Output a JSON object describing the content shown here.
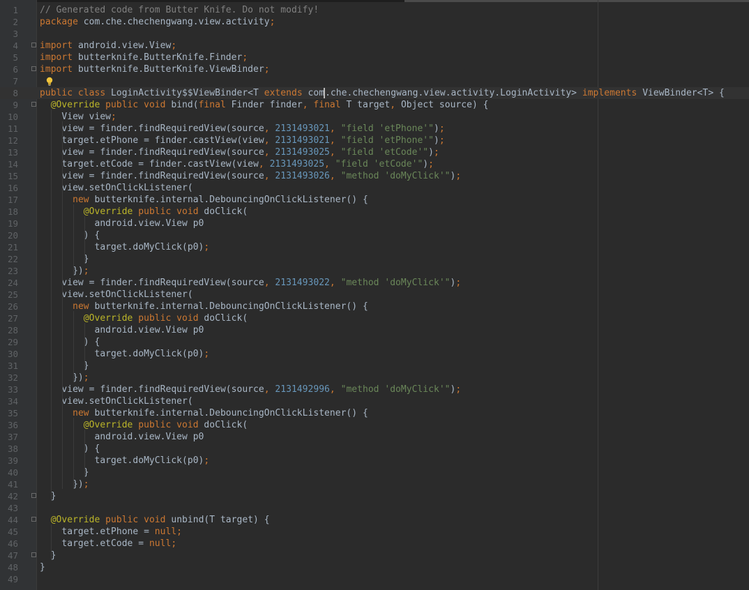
{
  "editor": {
    "theme_colors": {
      "background": "#2b2b2b",
      "gutter": "#313335",
      "line_number": "#606366",
      "keyword": "#cc7832",
      "comment": "#808080",
      "number": "#6897bb",
      "string": "#6a8759",
      "annotation": "#bbb529",
      "plain": "#a9b7c6"
    },
    "current_line": 8,
    "lines": [
      {
        "n": "1",
        "tokens": [
          [
            "cm",
            "// Generated code from Butter Knife. Do not modify!"
          ]
        ]
      },
      {
        "n": "2",
        "tokens": [
          [
            "kw",
            "package "
          ],
          [
            "pl",
            "com.che.chechengwang.view.activity"
          ],
          [
            "kw",
            ";"
          ]
        ]
      },
      {
        "n": "3",
        "tokens": []
      },
      {
        "n": "4",
        "tokens": [
          [
            "kw",
            "import "
          ],
          [
            "pl",
            "android.view.View"
          ],
          [
            "kw",
            ";"
          ]
        ]
      },
      {
        "n": "5",
        "tokens": [
          [
            "kw",
            "import "
          ],
          [
            "pl",
            "butterknife.ButterKnife.Finder"
          ],
          [
            "kw",
            ";"
          ]
        ]
      },
      {
        "n": "6",
        "tokens": [
          [
            "kw",
            "import "
          ],
          [
            "pl",
            "butterknife.ButterKnife.ViewBinder"
          ],
          [
            "kw",
            ";"
          ]
        ]
      },
      {
        "n": "7",
        "tokens": []
      },
      {
        "n": "8",
        "tokens": [
          [
            "kw",
            "public class "
          ],
          [
            "pl",
            "LoginActivity$$ViewBinder<T "
          ],
          [
            "kw",
            "extends "
          ],
          [
            "pl",
            "com"
          ],
          [
            "caret",
            ""
          ],
          [
            "pl",
            ".che.chechengwang.view.activity.LoginActivity> "
          ],
          [
            "kw",
            "implements "
          ],
          [
            "pl",
            "ViewBinder<T> {"
          ]
        ]
      },
      {
        "n": "9",
        "tokens": [
          [
            "pl",
            "  "
          ],
          [
            "ann",
            "@Override "
          ],
          [
            "kw",
            "public void "
          ],
          [
            "pl",
            "bind("
          ],
          [
            "kw",
            "final "
          ],
          [
            "pl",
            "Finder finder"
          ],
          [
            "kw",
            ", final "
          ],
          [
            "pl",
            "T target"
          ],
          [
            "kw",
            ", "
          ],
          [
            "pl",
            "Object source) {"
          ]
        ]
      },
      {
        "n": "10",
        "tokens": [
          [
            "pl",
            "    View view"
          ],
          [
            "kw",
            ";"
          ]
        ]
      },
      {
        "n": "11",
        "tokens": [
          [
            "pl",
            "    view = finder.findRequiredView(source"
          ],
          [
            "kw",
            ", "
          ],
          [
            "num",
            "2131493021"
          ],
          [
            "kw",
            ", "
          ],
          [
            "str",
            "\"field 'etPhone'\""
          ],
          [
            "pl",
            ")"
          ],
          [
            "kw",
            ";"
          ]
        ]
      },
      {
        "n": "12",
        "tokens": [
          [
            "pl",
            "    target.etPhone = finder.castView(view"
          ],
          [
            "kw",
            ", "
          ],
          [
            "num",
            "2131493021"
          ],
          [
            "kw",
            ", "
          ],
          [
            "str",
            "\"field 'etPhone'\""
          ],
          [
            "pl",
            ")"
          ],
          [
            "kw",
            ";"
          ]
        ]
      },
      {
        "n": "13",
        "tokens": [
          [
            "pl",
            "    view = finder.findRequiredView(source"
          ],
          [
            "kw",
            ", "
          ],
          [
            "num",
            "2131493025"
          ],
          [
            "kw",
            ", "
          ],
          [
            "str",
            "\"field 'etCode'\""
          ],
          [
            "pl",
            ")"
          ],
          [
            "kw",
            ";"
          ]
        ]
      },
      {
        "n": "14",
        "tokens": [
          [
            "pl",
            "    target.etCode = finder.castView(view"
          ],
          [
            "kw",
            ", "
          ],
          [
            "num",
            "2131493025"
          ],
          [
            "kw",
            ", "
          ],
          [
            "str",
            "\"field 'etCode'\""
          ],
          [
            "pl",
            ")"
          ],
          [
            "kw",
            ";"
          ]
        ]
      },
      {
        "n": "15",
        "tokens": [
          [
            "pl",
            "    view = finder.findRequiredView(source"
          ],
          [
            "kw",
            ", "
          ],
          [
            "num",
            "2131493026"
          ],
          [
            "kw",
            ", "
          ],
          [
            "str",
            "\"method 'doMyClick'\""
          ],
          [
            "pl",
            ")"
          ],
          [
            "kw",
            ";"
          ]
        ]
      },
      {
        "n": "16",
        "tokens": [
          [
            "pl",
            "    view.setOnClickListener("
          ]
        ]
      },
      {
        "n": "17",
        "tokens": [
          [
            "pl",
            "      "
          ],
          [
            "kw",
            "new "
          ],
          [
            "pl",
            "butterknife.internal.DebouncingOnClickListener() {"
          ]
        ]
      },
      {
        "n": "18",
        "tokens": [
          [
            "pl",
            "        "
          ],
          [
            "ann",
            "@Override "
          ],
          [
            "kw",
            "public void "
          ],
          [
            "pl",
            "doClick("
          ]
        ]
      },
      {
        "n": "19",
        "tokens": [
          [
            "pl",
            "          android.view.View p0"
          ]
        ]
      },
      {
        "n": "20",
        "tokens": [
          [
            "pl",
            "        ) {"
          ]
        ]
      },
      {
        "n": "21",
        "tokens": [
          [
            "pl",
            "          target.doMyClick(p0)"
          ],
          [
            "kw",
            ";"
          ]
        ]
      },
      {
        "n": "22",
        "tokens": [
          [
            "pl",
            "        }"
          ]
        ]
      },
      {
        "n": "23",
        "tokens": [
          [
            "pl",
            "      })"
          ],
          [
            "kw",
            ";"
          ]
        ]
      },
      {
        "n": "24",
        "tokens": [
          [
            "pl",
            "    view = finder.findRequiredView(source"
          ],
          [
            "kw",
            ", "
          ],
          [
            "num",
            "2131493022"
          ],
          [
            "kw",
            ", "
          ],
          [
            "str",
            "\"method 'doMyClick'\""
          ],
          [
            "pl",
            ")"
          ],
          [
            "kw",
            ";"
          ]
        ]
      },
      {
        "n": "25",
        "tokens": [
          [
            "pl",
            "    view.setOnClickListener("
          ]
        ]
      },
      {
        "n": "26",
        "tokens": [
          [
            "pl",
            "      "
          ],
          [
            "kw",
            "new "
          ],
          [
            "pl",
            "butterknife.internal.DebouncingOnClickListener() {"
          ]
        ]
      },
      {
        "n": "27",
        "tokens": [
          [
            "pl",
            "        "
          ],
          [
            "ann",
            "@Override "
          ],
          [
            "kw",
            "public void "
          ],
          [
            "pl",
            "doClick("
          ]
        ]
      },
      {
        "n": "28",
        "tokens": [
          [
            "pl",
            "          android.view.View p0"
          ]
        ]
      },
      {
        "n": "29",
        "tokens": [
          [
            "pl",
            "        ) {"
          ]
        ]
      },
      {
        "n": "30",
        "tokens": [
          [
            "pl",
            "          target.doMyClick(p0)"
          ],
          [
            "kw",
            ";"
          ]
        ]
      },
      {
        "n": "31",
        "tokens": [
          [
            "pl",
            "        }"
          ]
        ]
      },
      {
        "n": "32",
        "tokens": [
          [
            "pl",
            "      })"
          ],
          [
            "kw",
            ";"
          ]
        ]
      },
      {
        "n": "33",
        "tokens": [
          [
            "pl",
            "    view = finder.findRequiredView(source"
          ],
          [
            "kw",
            ", "
          ],
          [
            "num",
            "2131492996"
          ],
          [
            "kw",
            ", "
          ],
          [
            "str",
            "\"method 'doMyClick'\""
          ],
          [
            "pl",
            ")"
          ],
          [
            "kw",
            ";"
          ]
        ]
      },
      {
        "n": "34",
        "tokens": [
          [
            "pl",
            "    view.setOnClickListener("
          ]
        ]
      },
      {
        "n": "35",
        "tokens": [
          [
            "pl",
            "      "
          ],
          [
            "kw",
            "new "
          ],
          [
            "pl",
            "butterknife.internal.DebouncingOnClickListener() {"
          ]
        ]
      },
      {
        "n": "36",
        "tokens": [
          [
            "pl",
            "        "
          ],
          [
            "ann",
            "@Override "
          ],
          [
            "kw",
            "public void "
          ],
          [
            "pl",
            "doClick("
          ]
        ]
      },
      {
        "n": "37",
        "tokens": [
          [
            "pl",
            "          android.view.View p0"
          ]
        ]
      },
      {
        "n": "38",
        "tokens": [
          [
            "pl",
            "        ) {"
          ]
        ]
      },
      {
        "n": "39",
        "tokens": [
          [
            "pl",
            "          target.doMyClick(p0)"
          ],
          [
            "kw",
            ";"
          ]
        ]
      },
      {
        "n": "40",
        "tokens": [
          [
            "pl",
            "        }"
          ]
        ]
      },
      {
        "n": "41",
        "tokens": [
          [
            "pl",
            "      })"
          ],
          [
            "kw",
            ";"
          ]
        ]
      },
      {
        "n": "42",
        "tokens": [
          [
            "pl",
            "  }"
          ]
        ]
      },
      {
        "n": "43",
        "tokens": []
      },
      {
        "n": "44",
        "tokens": [
          [
            "pl",
            "  "
          ],
          [
            "ann",
            "@Override "
          ],
          [
            "kw",
            "public void "
          ],
          [
            "pl",
            "unbind(T target) {"
          ]
        ]
      },
      {
        "n": "45",
        "tokens": [
          [
            "pl",
            "    target.etPhone = "
          ],
          [
            "kw",
            "null;"
          ]
        ]
      },
      {
        "n": "46",
        "tokens": [
          [
            "pl",
            "    target.etCode = "
          ],
          [
            "kw",
            "null;"
          ]
        ]
      },
      {
        "n": "47",
        "tokens": [
          [
            "pl",
            "  }"
          ]
        ]
      },
      {
        "n": "48",
        "tokens": [
          [
            "pl",
            "}"
          ]
        ]
      },
      {
        "n": "49",
        "tokens": []
      }
    ],
    "fold_markers": [
      4,
      6,
      9,
      42,
      44,
      47
    ],
    "intention_bulb_line": 7,
    "icons": {
      "fold": "fold-marker-icon",
      "bulb": "lightbulb-icon"
    }
  }
}
